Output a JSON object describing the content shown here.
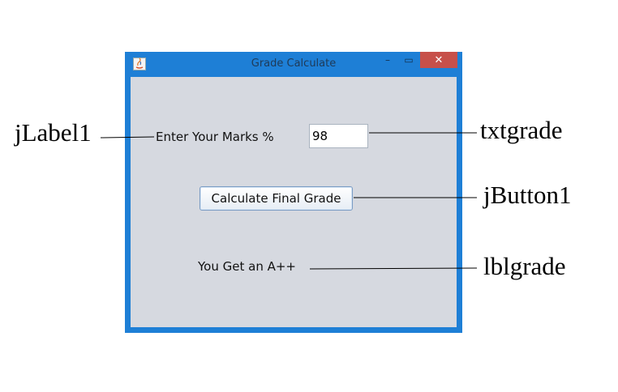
{
  "window": {
    "title": "Grade Calculate",
    "controls": {
      "minimize": "–",
      "maximize": "▭",
      "close": "✕"
    }
  },
  "form": {
    "marks_label": "Enter Your Marks %",
    "marks_value": "98",
    "button_label": "Calculate Final Grade",
    "result_text": "You Get an A++"
  },
  "annotations": {
    "label": "jLabel1",
    "textfield": "txtgrade",
    "button": "jButton1",
    "result": "lblgrade"
  },
  "colors": {
    "window_frame": "#1e7fd6",
    "client_bg": "#d6d9e0",
    "close_button": "#c7504a"
  }
}
